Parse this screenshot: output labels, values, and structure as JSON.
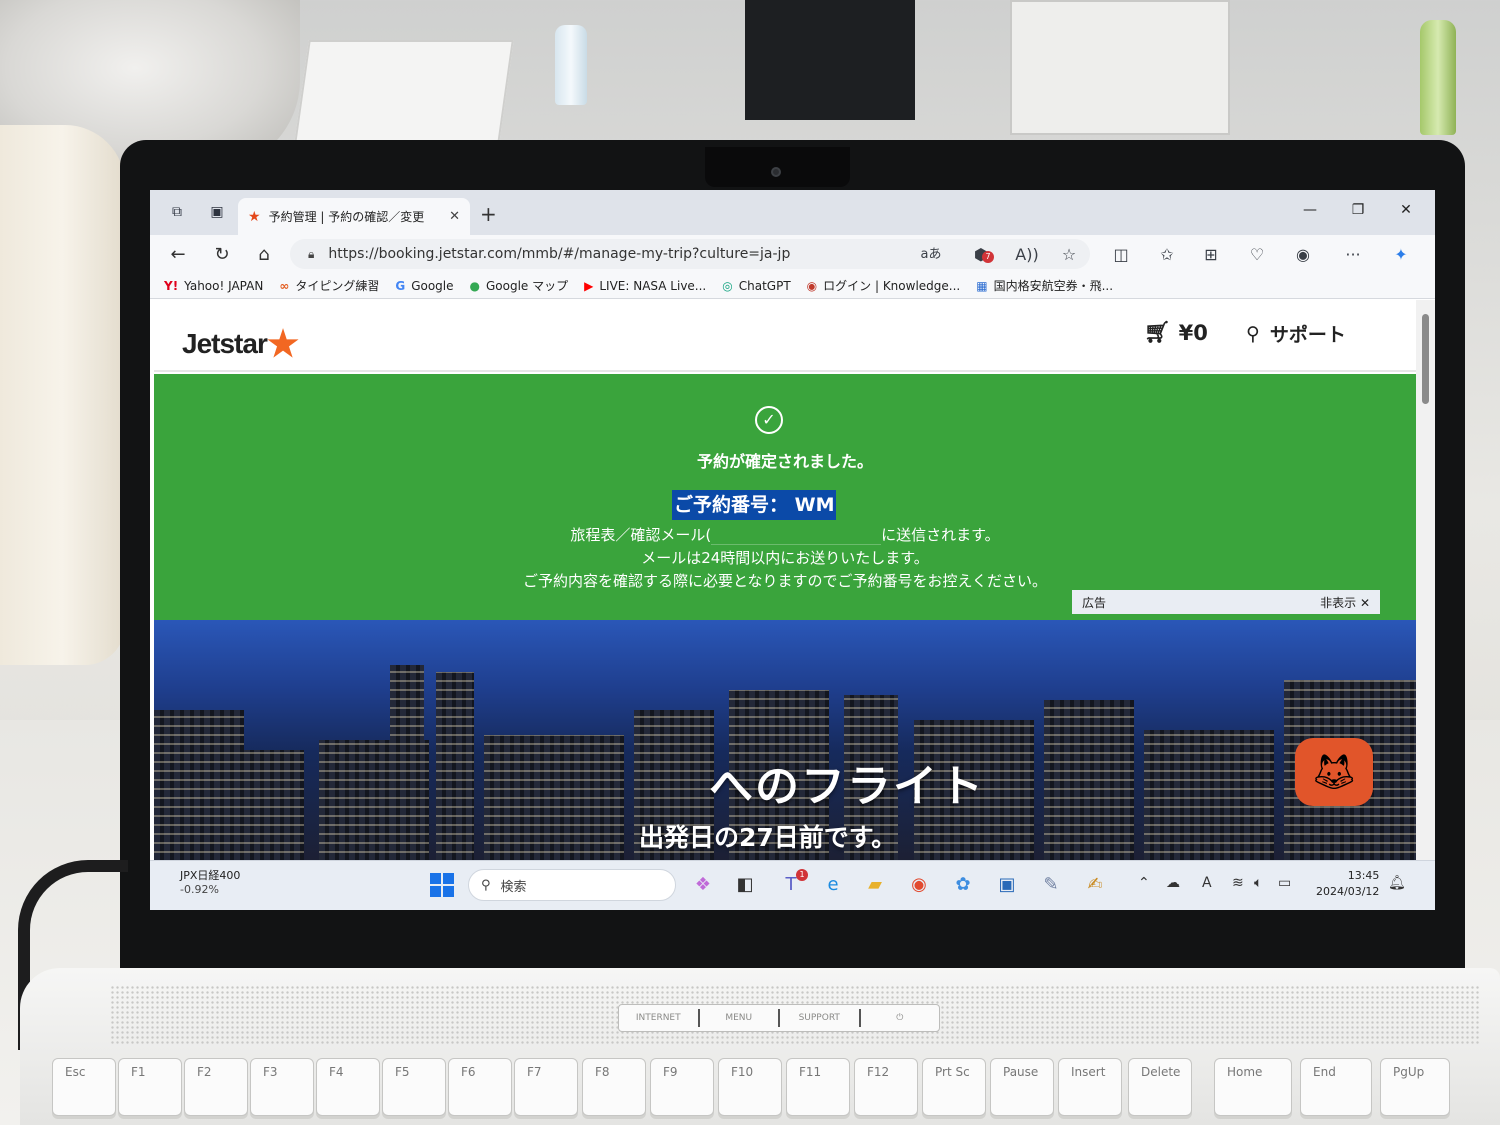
{
  "browser": {
    "tab_title": "予約管理 | 予約の確認／変更",
    "new_tab": "+",
    "url": "https://booking.jetstar.com/mmb/#/manage-my-trip?culture=ja-jp",
    "read_aloud": "aあ",
    "extension_badge": "7",
    "window_controls": {
      "minimize": "—",
      "restore": "❐",
      "close": "✕"
    }
  },
  "favorites": [
    {
      "icon": "Y!",
      "label": "Yahoo! JAPAN"
    },
    {
      "icon": "∞",
      "label": "タイピング練習"
    },
    {
      "icon": "G",
      "label": "Google"
    },
    {
      "icon": "●",
      "label": "Google マップ"
    },
    {
      "icon": "▶",
      "label": "LIVE: NASA Live..."
    },
    {
      "icon": "◎",
      "label": "ChatGPT"
    },
    {
      "icon": "◉",
      "label": "ログイン | Knowledge..."
    },
    {
      "icon": "▦",
      "label": "国内格安航空券・飛..."
    }
  ],
  "site": {
    "logo": "Jetstar",
    "cart_amount": "¥0",
    "support": "サポート"
  },
  "confirmation": {
    "title": "予約が確定されました。",
    "booking_ref": "ご予約番号： WM",
    "email_prefix": "旅程表／確認メール(",
    "email_suffix": "に送信されます。",
    "line2": "メールは24時間以内にお送りいたします。",
    "line3": "ご予約内容を確認する際に必要となりますのでご予約番号をお控えください。"
  },
  "ad": {
    "label": "広告",
    "hide": "非表示"
  },
  "hero": {
    "title": "へのフライト",
    "subtitle": "出発日の27日前です。"
  },
  "taskbar": {
    "widget_name": "JPX日経400",
    "widget_change": "-0.92%",
    "search_placeholder": "検索",
    "teams_badge": "1",
    "time": "13:45",
    "date": "2024/03/12"
  },
  "keyboard": {
    "media_keys": [
      "INTERNET",
      "MENU",
      "SUPPORT",
      "⏻"
    ],
    "keys": [
      "Esc",
      "F1",
      "F2",
      "F3",
      "F4",
      "F5",
      "F6",
      "F7",
      "F8",
      "F9",
      "F10",
      "F11",
      "F12",
      "Prt Sc",
      "Pause",
      "Insert",
      "Delete",
      "Home",
      "End",
      "PgUp"
    ]
  }
}
